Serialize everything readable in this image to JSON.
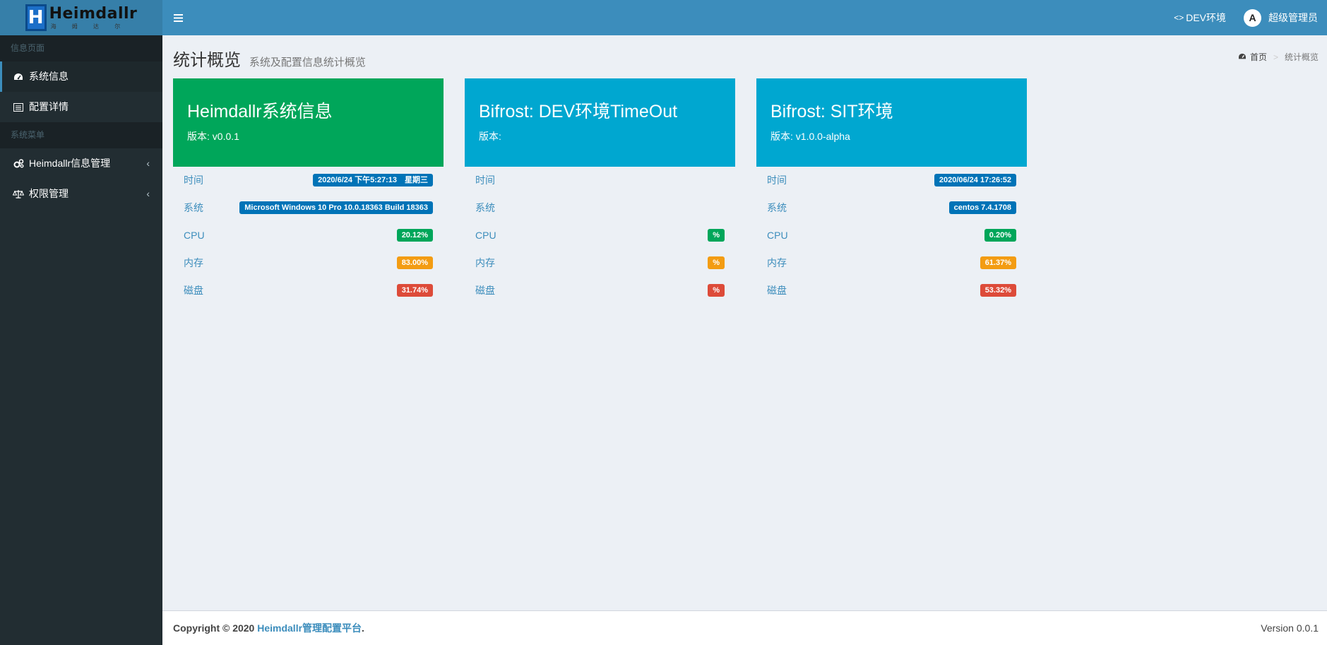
{
  "logo": {
    "title": "Heimdallr",
    "subtitle": "海 姆 达 尔"
  },
  "sidebar": {
    "sections": [
      {
        "header": "信息页面"
      },
      {
        "header": "系统菜单"
      }
    ],
    "items": [
      {
        "label": "系统信息",
        "icon": "dashboard-icon"
      },
      {
        "label": "配置详情",
        "icon": "list-icon"
      },
      {
        "label": "Heimdallr信息管理",
        "icon": "gears-icon"
      },
      {
        "label": "权限管理",
        "icon": "balance-scale-icon"
      }
    ]
  },
  "topbar": {
    "env_label": "DEV环境",
    "user_name": "超级管理员",
    "avatar_letter": "A"
  },
  "page": {
    "title": "统计概览",
    "subtitle": "系统及配置信息统计概览",
    "breadcrumb_home": "首页",
    "breadcrumb_sep": ">",
    "breadcrumb_current": "统计概览"
  },
  "cards": [
    {
      "title": "Heimdallr系统信息",
      "version": "版本: v0.0.1",
      "color": "#00a65a",
      "rows": [
        {
          "label": "时间",
          "value": "2020/6/24 下午5:27:13　星期三",
          "color": "#0073b7"
        },
        {
          "label": "系统",
          "value": "Microsoft Windows 10 Pro 10.0.18363 Build 18363",
          "color": "#0073b7"
        },
        {
          "label": "CPU",
          "value": "20.12%",
          "color": "#00a65a"
        },
        {
          "label": "内存",
          "value": "83.00%",
          "color": "#f39c12"
        },
        {
          "label": "磁盘",
          "value": "31.74%",
          "color": "#dd4b39"
        }
      ]
    },
    {
      "title": "Bifrost: DEV环境TimeOut",
      "version": "版本:",
      "color": "#00a7d0",
      "rows": [
        {
          "label": "时间",
          "value": ""
        },
        {
          "label": "系统",
          "value": ""
        },
        {
          "label": "CPU",
          "value": "%",
          "color": "#00a65a"
        },
        {
          "label": "内存",
          "value": "%",
          "color": "#f39c12"
        },
        {
          "label": "磁盘",
          "value": "%",
          "color": "#dd4b39"
        }
      ]
    },
    {
      "title": "Bifrost: SIT环境",
      "version": "版本: v1.0.0-alpha",
      "color": "#00a7d0",
      "rows": [
        {
          "label": "时间",
          "value": "2020/06/24 17:26:52",
          "color": "#0073b7"
        },
        {
          "label": "系统",
          "value": "centos 7.4.1708",
          "color": "#0073b7"
        },
        {
          "label": "CPU",
          "value": "0.20%",
          "color": "#00a65a"
        },
        {
          "label": "内存",
          "value": "61.37%",
          "color": "#f39c12"
        },
        {
          "label": "磁盘",
          "value": "53.32%",
          "color": "#dd4b39"
        }
      ]
    }
  ],
  "footer": {
    "copyright": "Copyright © 2020",
    "brand": "Heimdallr管理配置平台",
    "suffix": ".",
    "version": "Version 0.0.1"
  }
}
